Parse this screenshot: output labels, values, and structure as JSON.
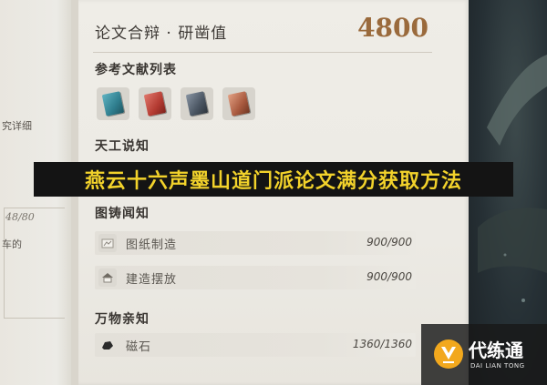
{
  "left_panel": {
    "fragment_1": "究详细",
    "fragment_2": "48/80",
    "fragment_3": "车的"
  },
  "header": {
    "title": "论文合辩 · 研凿值",
    "value": "4800"
  },
  "references": {
    "label": "参考文献列表",
    "books": [
      {
        "icon": "book-teal-icon",
        "color": "#2f7e8e"
      },
      {
        "icon": "book-red-icon",
        "color": "#b43b32"
      },
      {
        "icon": "book-slate-icon",
        "color": "#4a5562"
      },
      {
        "icon": "book-rust-icon",
        "color": "#a8593e"
      }
    ]
  },
  "sections": {
    "tiangong": "天工说知",
    "tuzhu": "图铸闻知",
    "wanwu": "万物亲知"
  },
  "rows": [
    {
      "name": "图纸制造",
      "value": "900/900",
      "icon": "blueprint-icon"
    },
    {
      "name": "建造摆放",
      "value": "900/900",
      "icon": "building-icon"
    },
    {
      "name": "磁石",
      "value": "1360/1360",
      "icon": "magnet-stone-icon"
    }
  ],
  "banner": {
    "text": "燕云十六声墨山道门派论文满分获取方法"
  },
  "watermark": {
    "name": "代练通",
    "subtitle": "DAI LIAN TONG"
  }
}
